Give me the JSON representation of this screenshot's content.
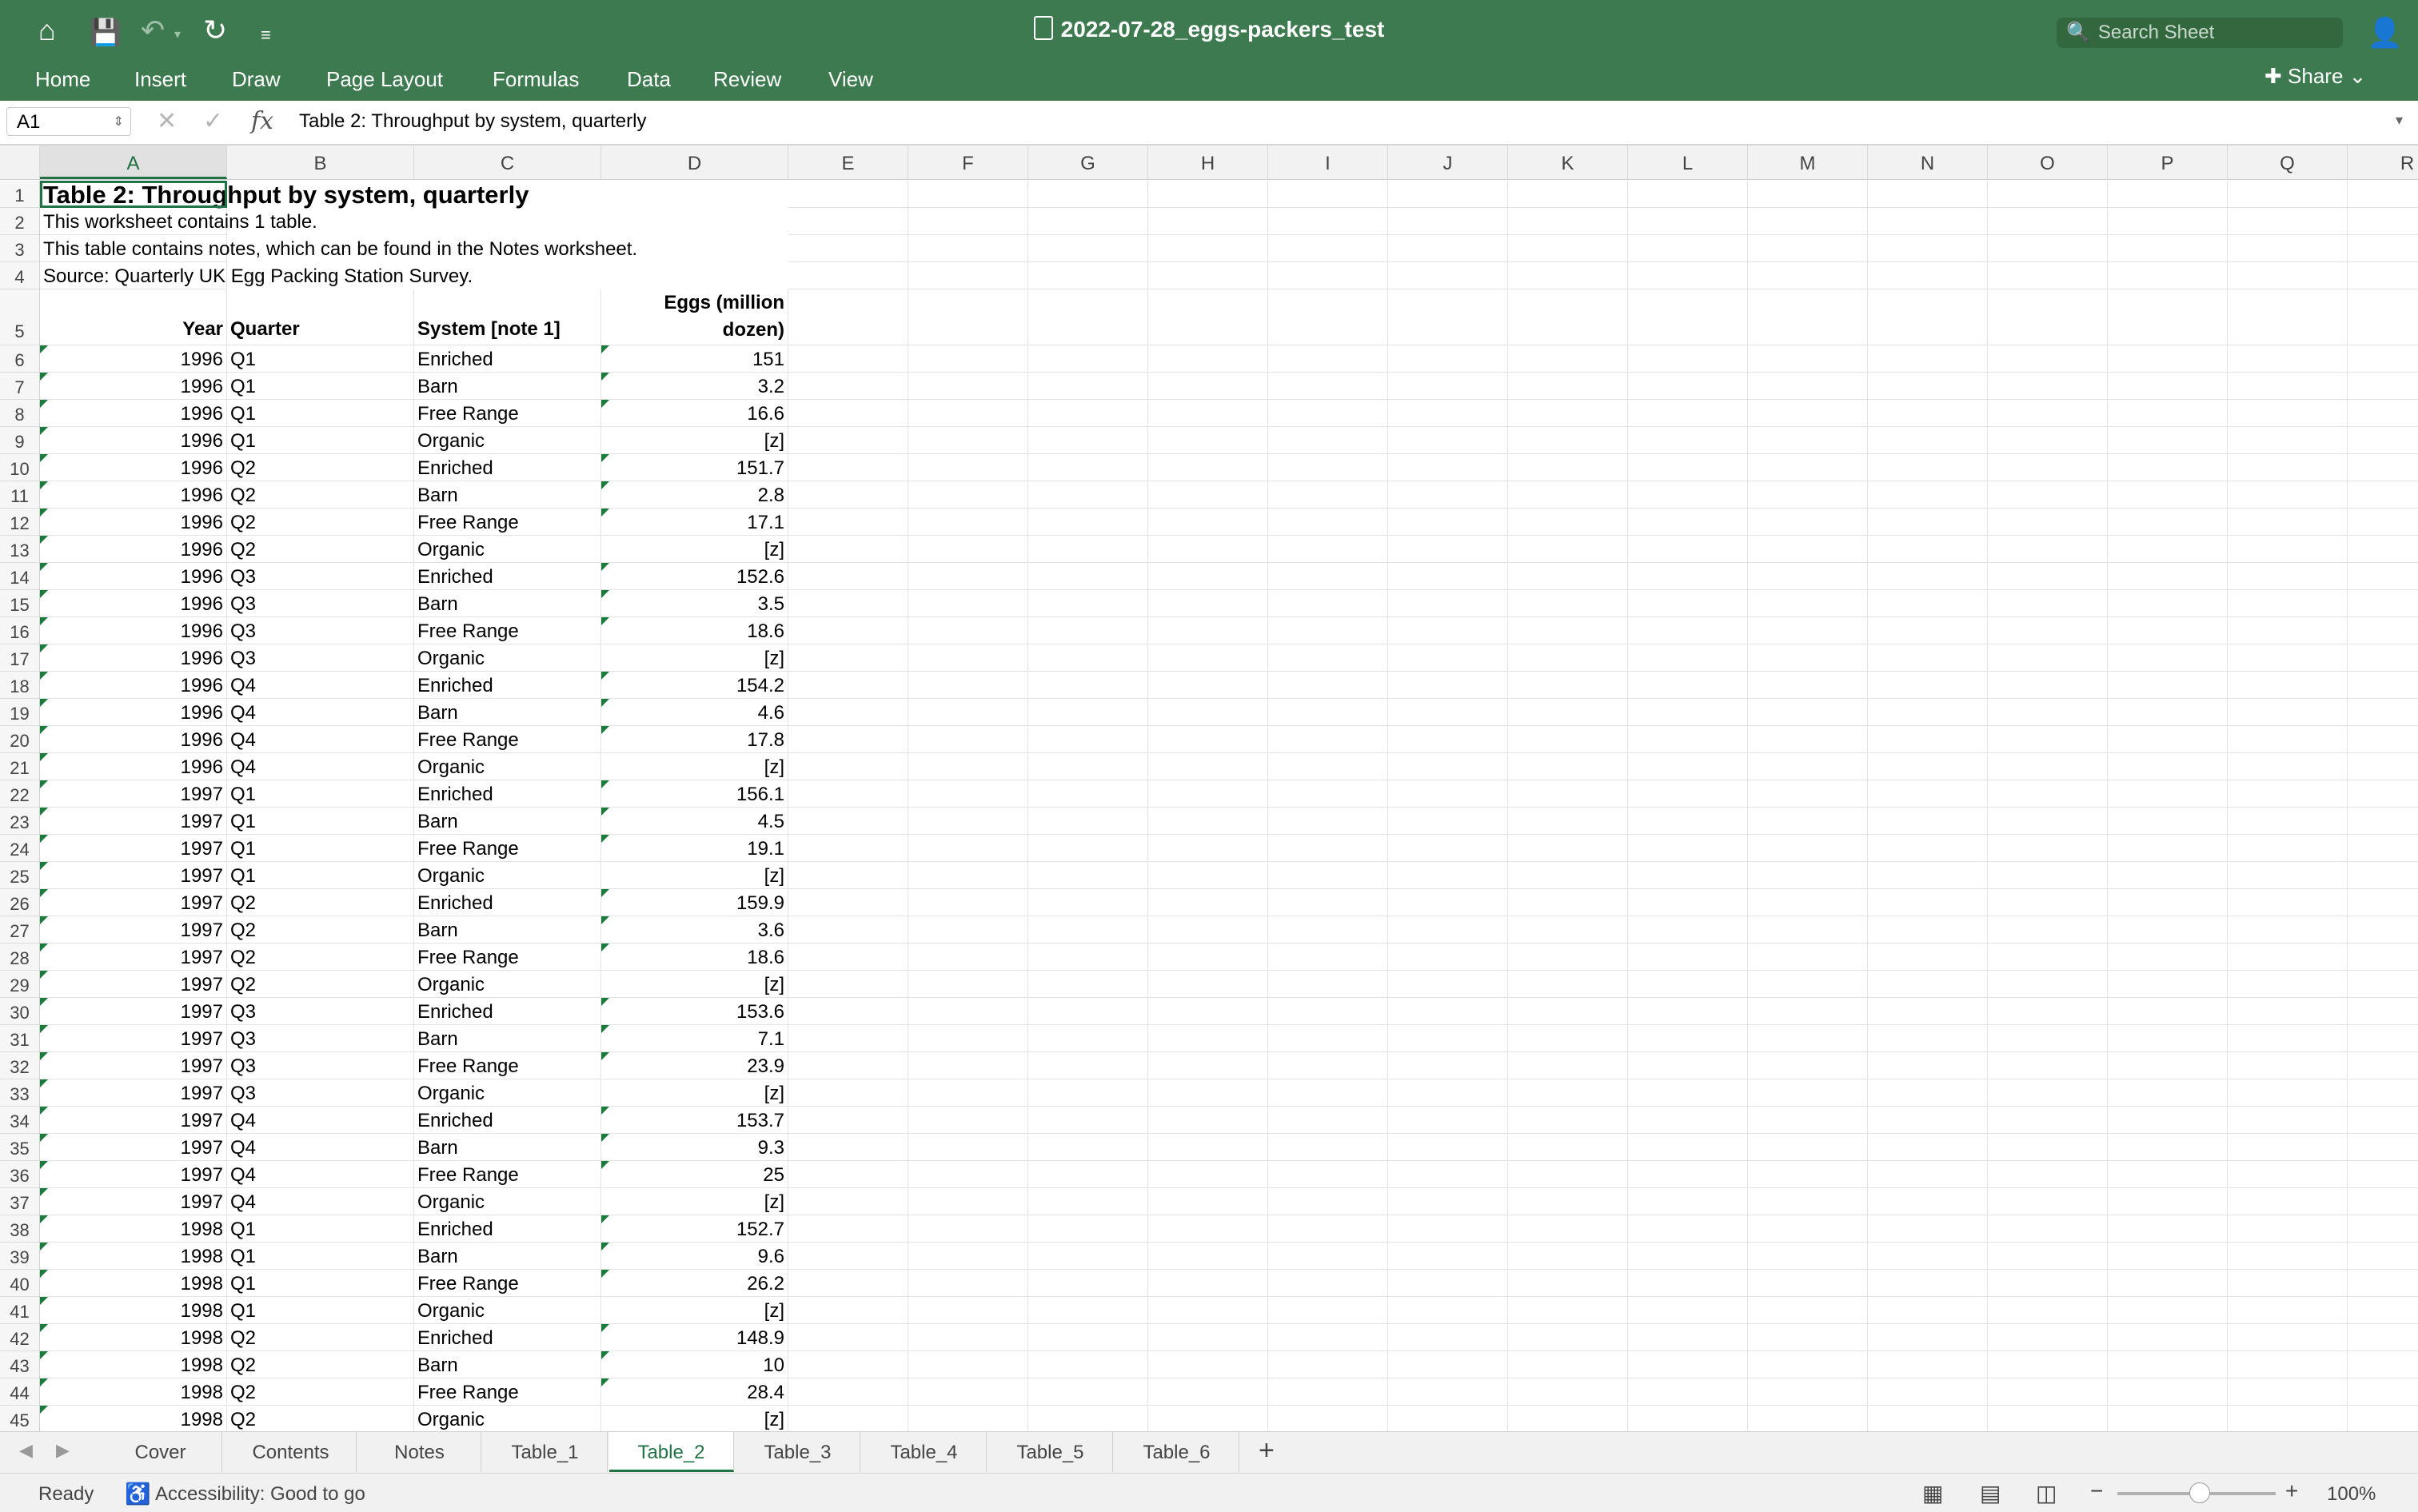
{
  "window": {
    "title": "2022-07-28_eggs-packers_test",
    "search_placeholder": "Search Sheet",
    "share_label": "Share"
  },
  "menu": [
    "Home",
    "Insert",
    "Draw",
    "Page Layout",
    "Formulas",
    "Data",
    "Review",
    "View"
  ],
  "formula_bar": {
    "cell_ref": "A1",
    "formula": "Table 2: Throughput by system, quarterly"
  },
  "columns": [
    "A",
    "B",
    "C",
    "D",
    "E",
    "F",
    "G",
    "H",
    "I",
    "J",
    "K",
    "L",
    "M",
    "N",
    "O",
    "P",
    "Q",
    "R"
  ],
  "header_rows": {
    "r1": "Table 2: Throughput by system, quarterly",
    "r2": "This worksheet contains 1 table.",
    "r3": "This table contains notes, which can be found in the Notes worksheet.",
    "r4": "Source: Quarterly UK Egg Packing Station Survey.",
    "col_year": "Year",
    "col_quarter": "Quarter",
    "col_system": "System [note 1]",
    "col_eggs_1": "Eggs (million",
    "col_eggs_2": "dozen)"
  },
  "data_rows": [
    [
      "1996",
      "Q1",
      "Enriched",
      "151"
    ],
    [
      "1996",
      "Q1",
      "Barn",
      "3.2"
    ],
    [
      "1996",
      "Q1",
      "Free Range",
      "16.6"
    ],
    [
      "1996",
      "Q1",
      "Organic",
      "[z]"
    ],
    [
      "1996",
      "Q2",
      "Enriched",
      "151.7"
    ],
    [
      "1996",
      "Q2",
      "Barn",
      "2.8"
    ],
    [
      "1996",
      "Q2",
      "Free Range",
      "17.1"
    ],
    [
      "1996",
      "Q2",
      "Organic",
      "[z]"
    ],
    [
      "1996",
      "Q3",
      "Enriched",
      "152.6"
    ],
    [
      "1996",
      "Q3",
      "Barn",
      "3.5"
    ],
    [
      "1996",
      "Q3",
      "Free Range",
      "18.6"
    ],
    [
      "1996",
      "Q3",
      "Organic",
      "[z]"
    ],
    [
      "1996",
      "Q4",
      "Enriched",
      "154.2"
    ],
    [
      "1996",
      "Q4",
      "Barn",
      "4.6"
    ],
    [
      "1996",
      "Q4",
      "Free Range",
      "17.8"
    ],
    [
      "1996",
      "Q4",
      "Organic",
      "[z]"
    ],
    [
      "1997",
      "Q1",
      "Enriched",
      "156.1"
    ],
    [
      "1997",
      "Q1",
      "Barn",
      "4.5"
    ],
    [
      "1997",
      "Q1",
      "Free Range",
      "19.1"
    ],
    [
      "1997",
      "Q1",
      "Organic",
      "[z]"
    ],
    [
      "1997",
      "Q2",
      "Enriched",
      "159.9"
    ],
    [
      "1997",
      "Q2",
      "Barn",
      "3.6"
    ],
    [
      "1997",
      "Q2",
      "Free Range",
      "18.6"
    ],
    [
      "1997",
      "Q2",
      "Organic",
      "[z]"
    ],
    [
      "1997",
      "Q3",
      "Enriched",
      "153.6"
    ],
    [
      "1997",
      "Q3",
      "Barn",
      "7.1"
    ],
    [
      "1997",
      "Q3",
      "Free Range",
      "23.9"
    ],
    [
      "1997",
      "Q3",
      "Organic",
      "[z]"
    ],
    [
      "1997",
      "Q4",
      "Enriched",
      "153.7"
    ],
    [
      "1997",
      "Q4",
      "Barn",
      "9.3"
    ],
    [
      "1997",
      "Q4",
      "Free Range",
      "25"
    ],
    [
      "1997",
      "Q4",
      "Organic",
      "[z]"
    ],
    [
      "1998",
      "Q1",
      "Enriched",
      "152.7"
    ],
    [
      "1998",
      "Q1",
      "Barn",
      "9.6"
    ],
    [
      "1998",
      "Q1",
      "Free Range",
      "26.2"
    ],
    [
      "1998",
      "Q1",
      "Organic",
      "[z]"
    ],
    [
      "1998",
      "Q2",
      "Enriched",
      "148.9"
    ],
    [
      "1998",
      "Q2",
      "Barn",
      "10"
    ],
    [
      "1998",
      "Q2",
      "Free Range",
      "28.4"
    ],
    [
      "1998",
      "Q2",
      "Organic",
      "[z]"
    ]
  ],
  "sheet_tabs": [
    "Cover",
    "Contents",
    "Notes",
    "Table_1",
    "Table_2",
    "Table_3",
    "Table_4",
    "Table_5",
    "Table_6"
  ],
  "active_tab": "Table_2",
  "status": {
    "ready": "Ready",
    "accessibility": "Accessibility: Good to go",
    "zoom": "100%"
  }
}
